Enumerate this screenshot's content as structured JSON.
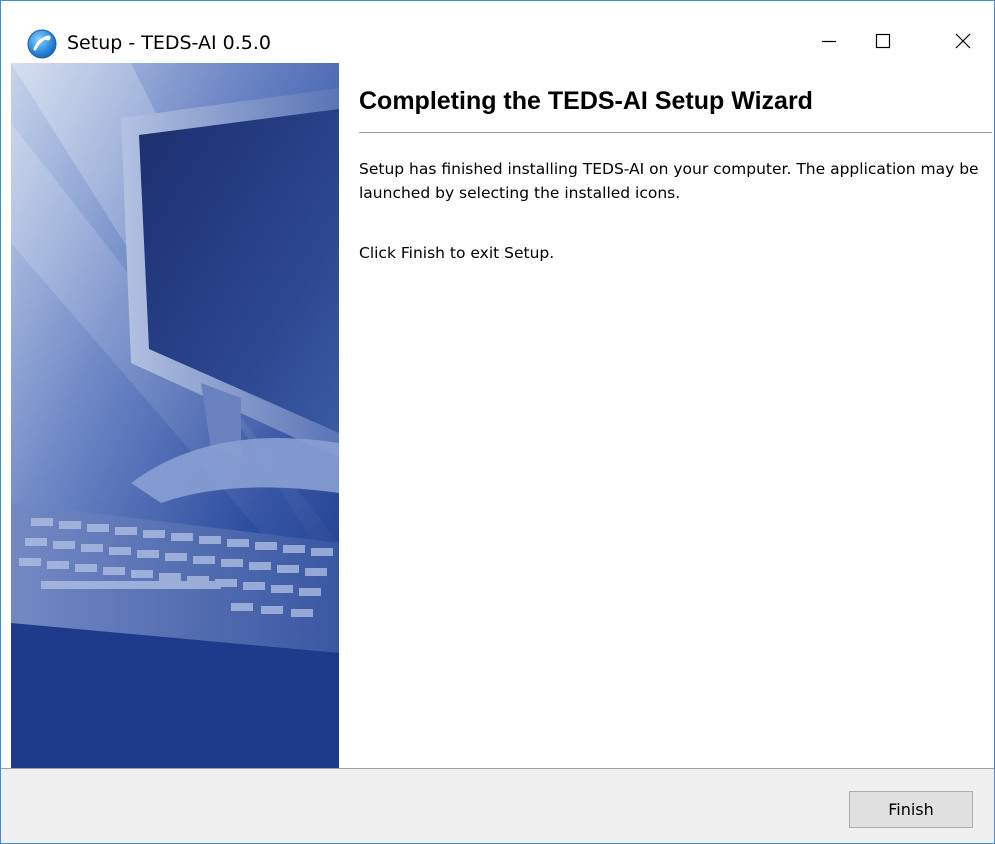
{
  "window": {
    "title": "Setup - TEDS-AI 0.5.0",
    "icon": "setup-globe-icon",
    "controls": {
      "minimize": "minimize-icon",
      "maximize": "maximize-icon",
      "close": "close-icon"
    },
    "accent_color": "#3c8fd6"
  },
  "wizard": {
    "heading": "Completing the TEDS-AI Setup Wizard",
    "paragraph1": "Setup has finished installing TEDS-AI on your computer. The application may be launched by selecting the installed icons.",
    "paragraph2": "Click Finish to exit Setup.",
    "banner_image": "computer-monitor-keyboard-illustration",
    "banner_color": "#2e4e9e"
  },
  "footer": {
    "finish_label": "Finish"
  }
}
